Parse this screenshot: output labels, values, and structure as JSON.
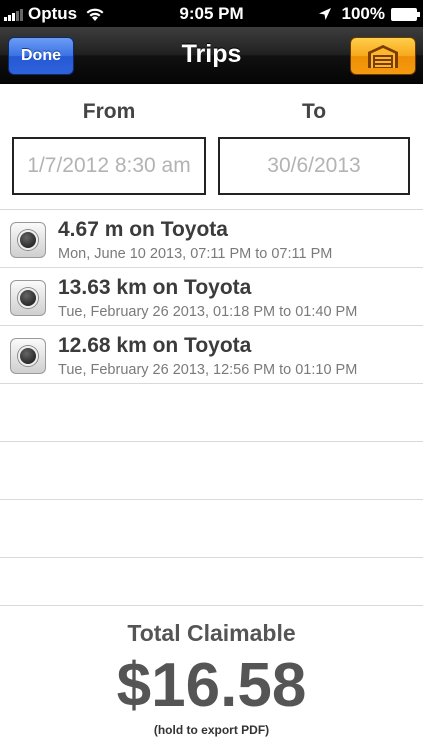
{
  "status_bar": {
    "carrier": "Optus",
    "time": "9:05 PM",
    "battery": "100%"
  },
  "nav": {
    "title": "Trips",
    "done_label": "Done",
    "garage_icon": "garage-icon",
    "colors": {
      "done": "#2e63dc",
      "garage": "#f49a10"
    }
  },
  "date_range": {
    "from_label": "From",
    "to_label": "To",
    "from_placeholder": "1/7/2012 8:30 am",
    "to_placeholder": "30/6/2013"
  },
  "trips": [
    {
      "title": "4.67 m on Toyota",
      "subtitle": "Mon, June 10 2013, 07:11 PM to 07:11 PM"
    },
    {
      "title": "13.63 km on Toyota",
      "subtitle": "Tue, February 26 2013, 01:18 PM to 01:40 PM"
    },
    {
      "title": "12.68 km on Toyota",
      "subtitle": "Tue, February 26 2013, 12:56 PM to 01:10 PM"
    }
  ],
  "footer": {
    "total_label": "Total Claimable",
    "total_amount": "$16.58",
    "export_hint": "(hold to export PDF)"
  }
}
